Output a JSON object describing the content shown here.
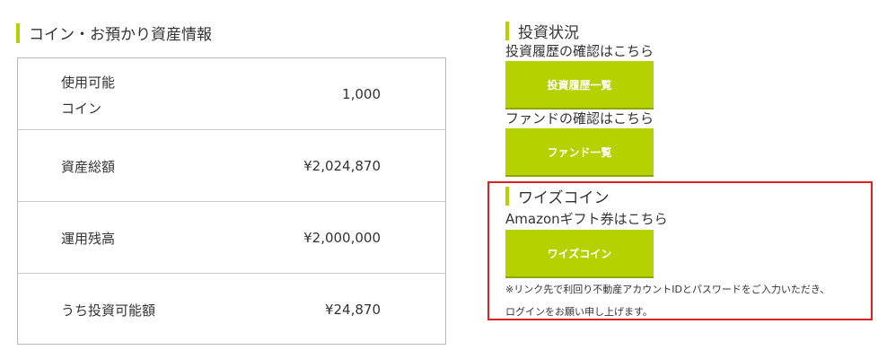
{
  "assets": {
    "heading": "コイン・お預かり資産情報",
    "rows": [
      {
        "label_line1": "使用可能",
        "label_line2": "コイン",
        "value": "1,000"
      },
      {
        "label": "資産総額",
        "value": "¥2,024,870"
      },
      {
        "label": "運用残高",
        "value": "¥2,000,000"
      },
      {
        "label": "うち投資可能額",
        "value": "¥24,870"
      }
    ]
  },
  "investment": {
    "heading": "投資状況",
    "history_text": "投資履歴の確認はこちら",
    "history_button": "投資履歴一覧",
    "fund_text": "ファンドの確認はこちら",
    "fund_button": "ファンド一覧"
  },
  "wise_coin": {
    "heading": "ワイズコイン",
    "amazon_text": "Amazonギフト券はこちら",
    "button": "ワイズコイン",
    "note_line1": "※リンク先で利回り不動産アカウントIDとパスワードをご入力いただき、",
    "note_line2": "ログインをお願い申し上げます。"
  },
  "colors": {
    "accent": "#b5d100",
    "highlight_border": "#e02020",
    "table_border": "#b8b8b8"
  }
}
